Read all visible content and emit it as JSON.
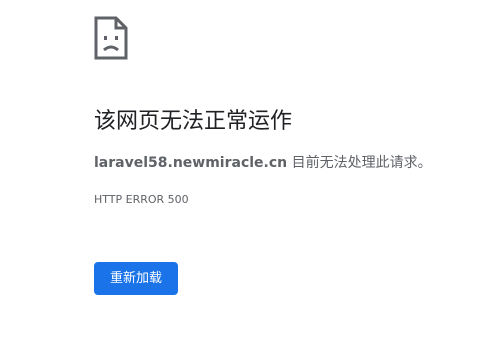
{
  "icon": "sad-page-icon",
  "headline": "该网页无法正常运作",
  "summary": {
    "host": "laravel58.newmiracle.cn",
    "message": " 目前无法处理此请求。"
  },
  "error_code": "HTTP ERROR 500",
  "reload_button": {
    "label": "重新加载",
    "color": "#1a73e8"
  }
}
